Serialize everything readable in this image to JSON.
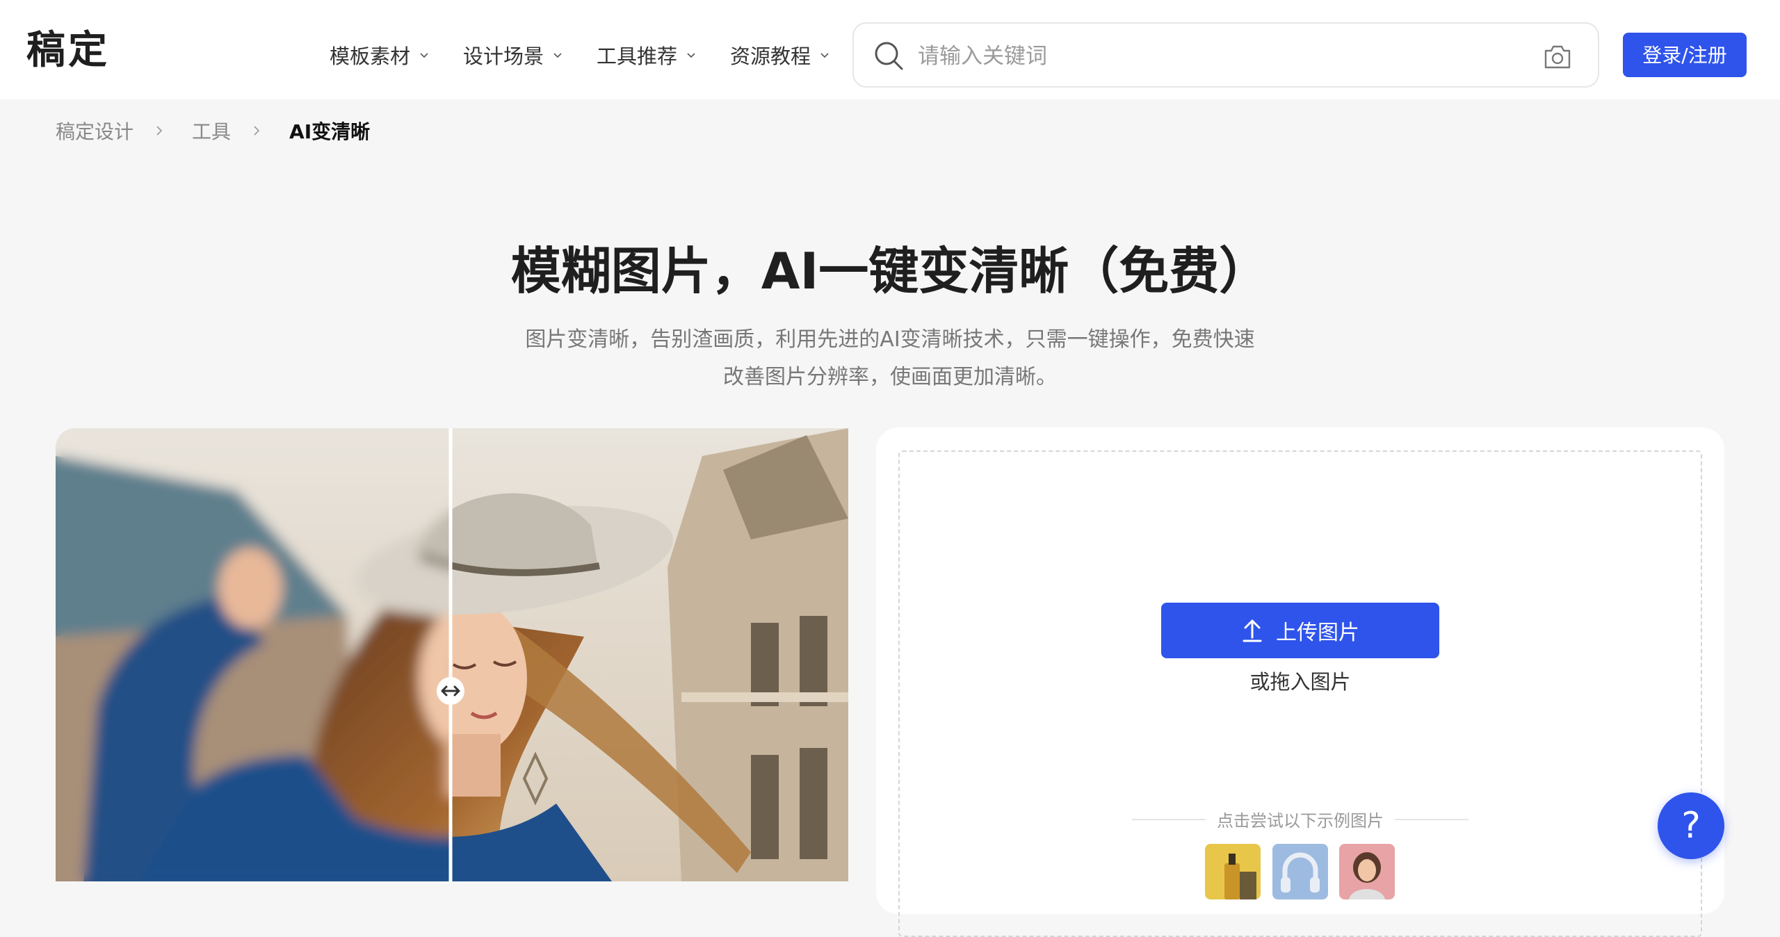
{
  "header": {
    "logo": "稿定",
    "nav": [
      {
        "label": "模板素材"
      },
      {
        "label": "设计场景"
      },
      {
        "label": "工具推荐"
      },
      {
        "label": "资源教程"
      }
    ],
    "search": {
      "placeholder": "请输入关键词"
    },
    "login_label": "登录/注册"
  },
  "breadcrumb": [
    "稿定设计",
    "工具",
    "AI变清晰"
  ],
  "hero": {
    "title": "模糊图片，AI一键变清晰（免费）",
    "subtitle_line1": "图片变清晰，告别渣画质，利用先进的AI变清晰技术，只需一键操作，免费快速",
    "subtitle_line2": "改善图片分辨率，使画面更加清晰。"
  },
  "upload": {
    "button_label": "上传图片",
    "drop_hint": "或拖入图片",
    "samples_label": "点击尝试以下示例图片",
    "help_label": "?"
  },
  "colors": {
    "accent": "#2f54eb",
    "background": "#f6f6f6"
  },
  "icons": [
    "chevron-down-icon",
    "search-icon",
    "camera-icon",
    "chevron-right-icon",
    "upload-arrow-icon",
    "drag-handle-icon",
    "help-icon"
  ]
}
